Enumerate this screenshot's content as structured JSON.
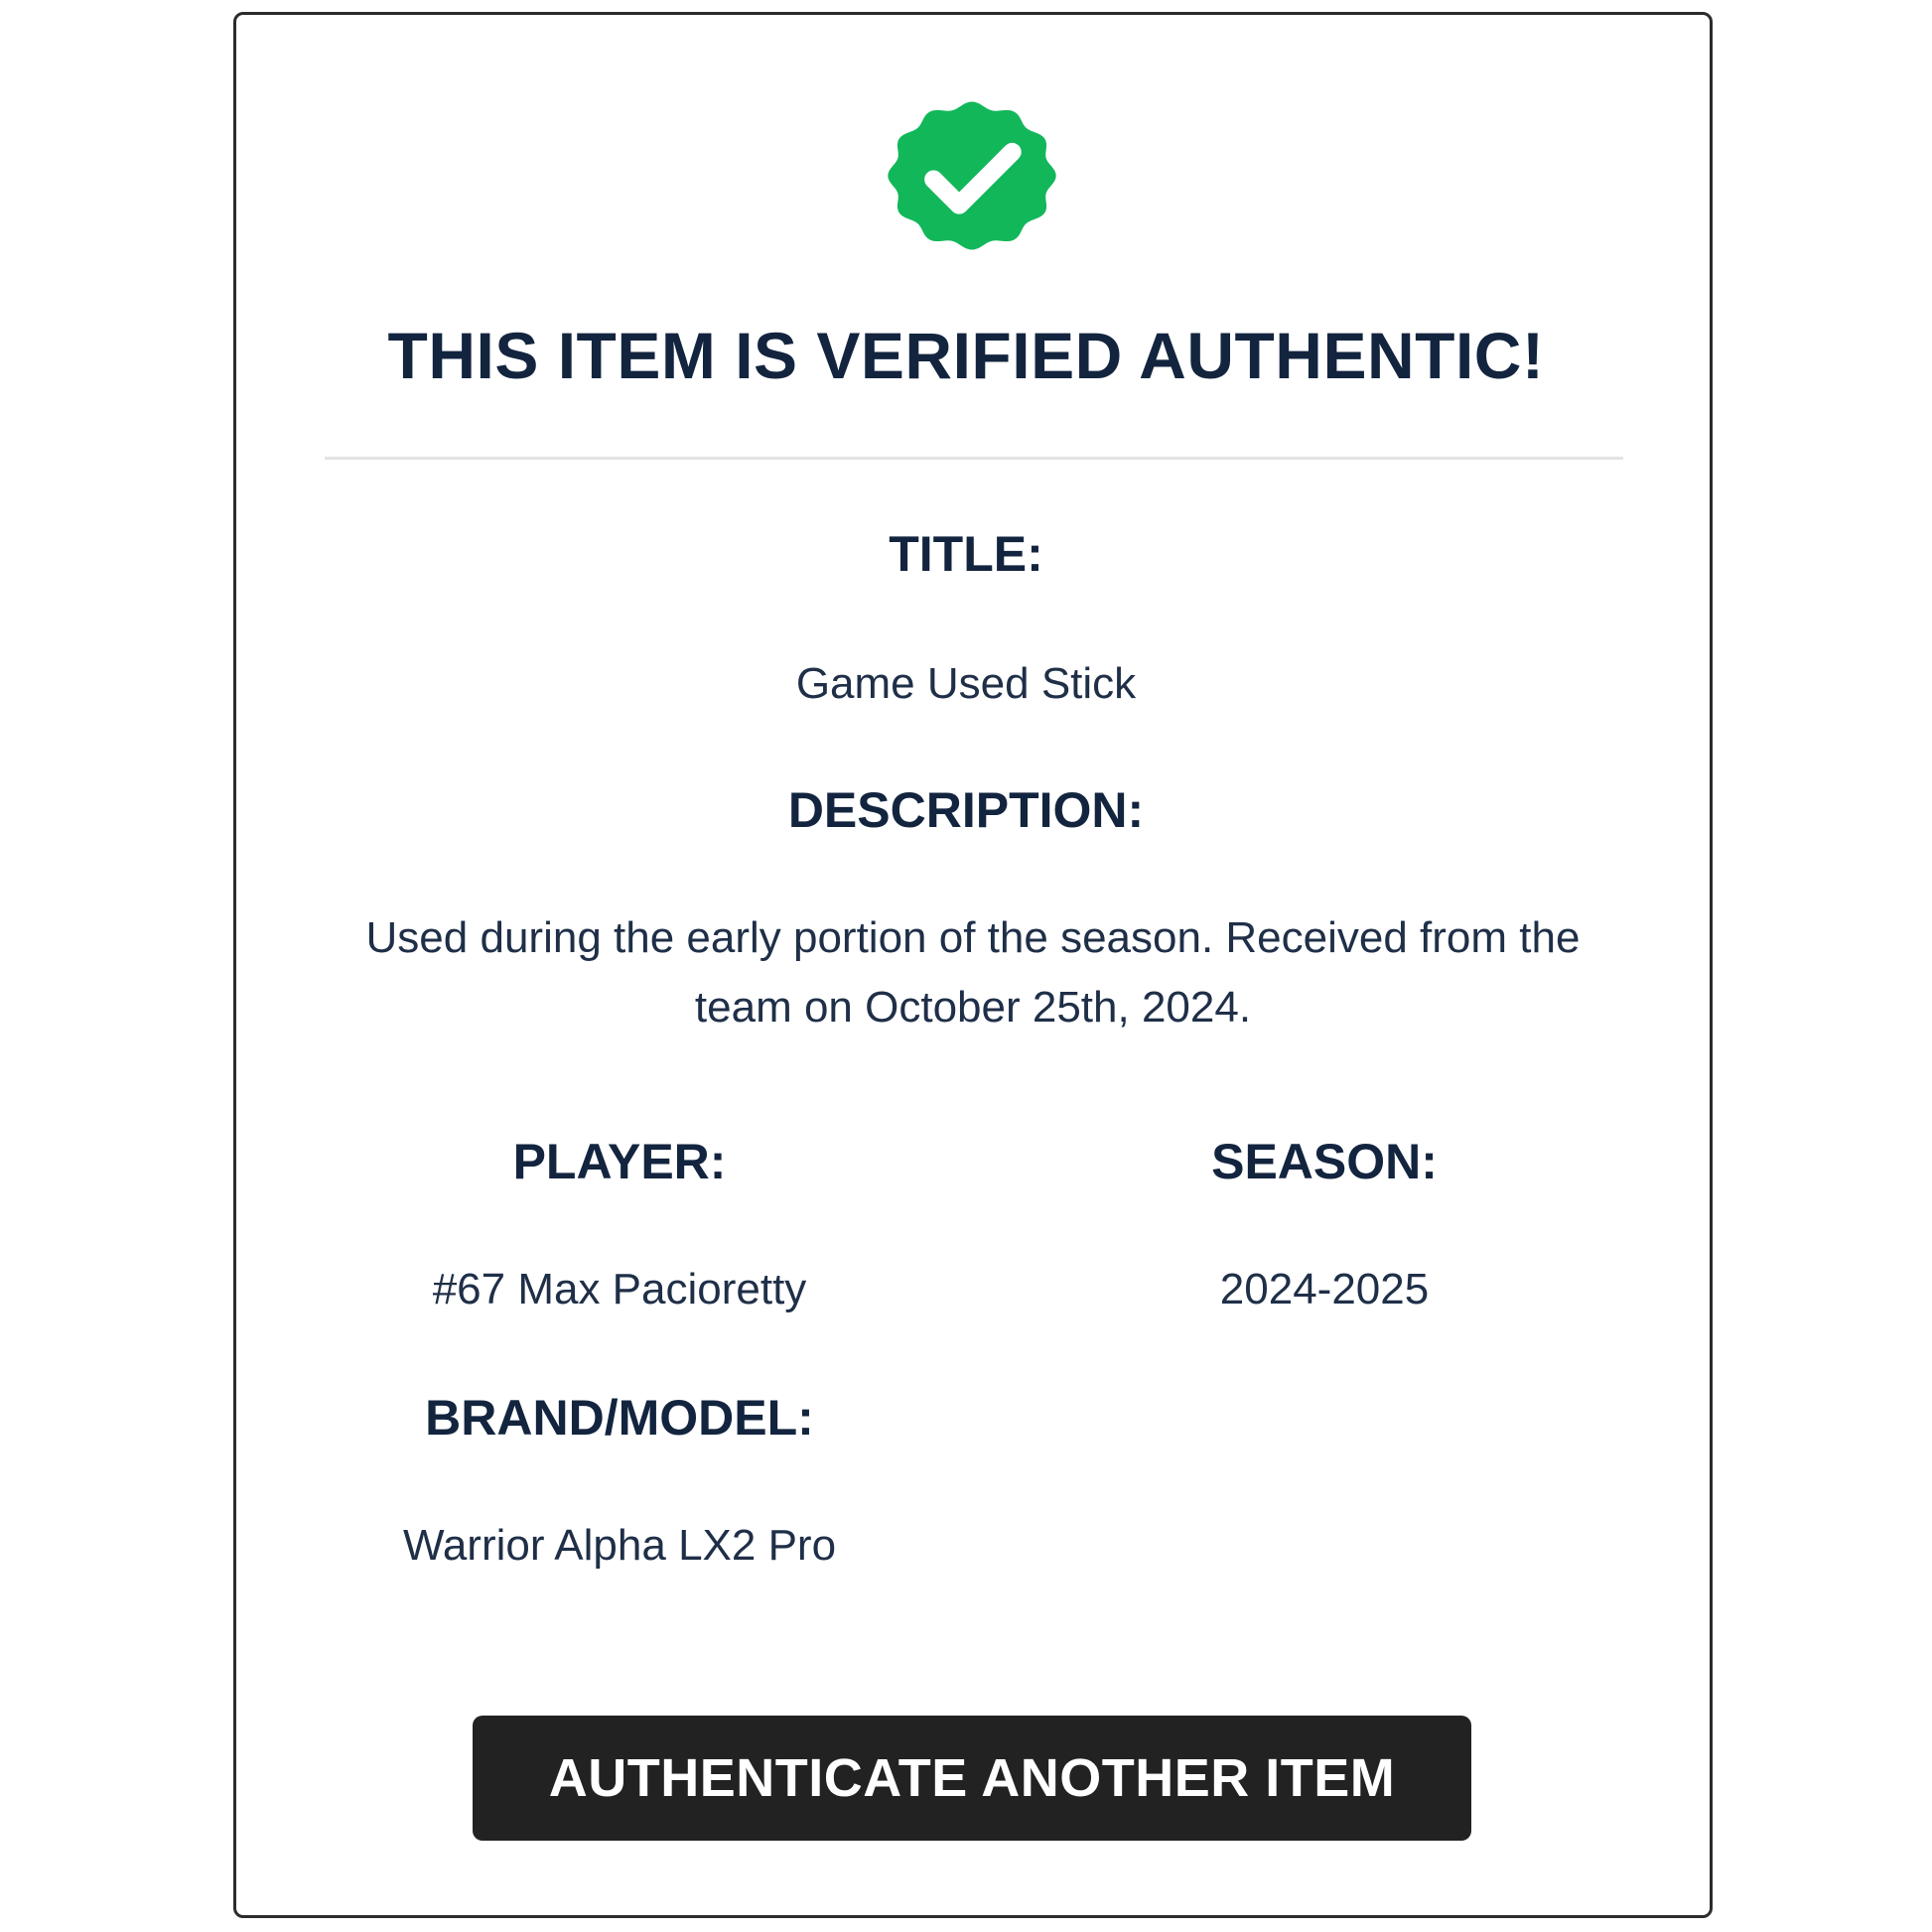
{
  "colors": {
    "badge": "#12b75a",
    "heading": "#13243f",
    "button_bg": "#222222",
    "button_text": "#ffffff"
  },
  "badge": {
    "icon": "verified-check-badge-icon"
  },
  "headline": "THIS ITEM IS VERIFIED AUTHENTIC!",
  "fields": {
    "title": {
      "label": "TITLE:",
      "value": "Game Used Stick"
    },
    "description": {
      "label": "DESCRIPTION:",
      "value": "Used during the early portion of the season. Received from the team on October 25th, 2024."
    },
    "player": {
      "label": "PLAYER:",
      "value": "#67 Max Pacioretty"
    },
    "season": {
      "label": "SEASON:",
      "value": "2024-2025"
    },
    "brand_model": {
      "label": "BRAND/MODEL:",
      "value": "Warrior Alpha LX2 Pro"
    }
  },
  "actions": {
    "authenticate_label": "AUTHENTICATE ANOTHER ITEM"
  }
}
